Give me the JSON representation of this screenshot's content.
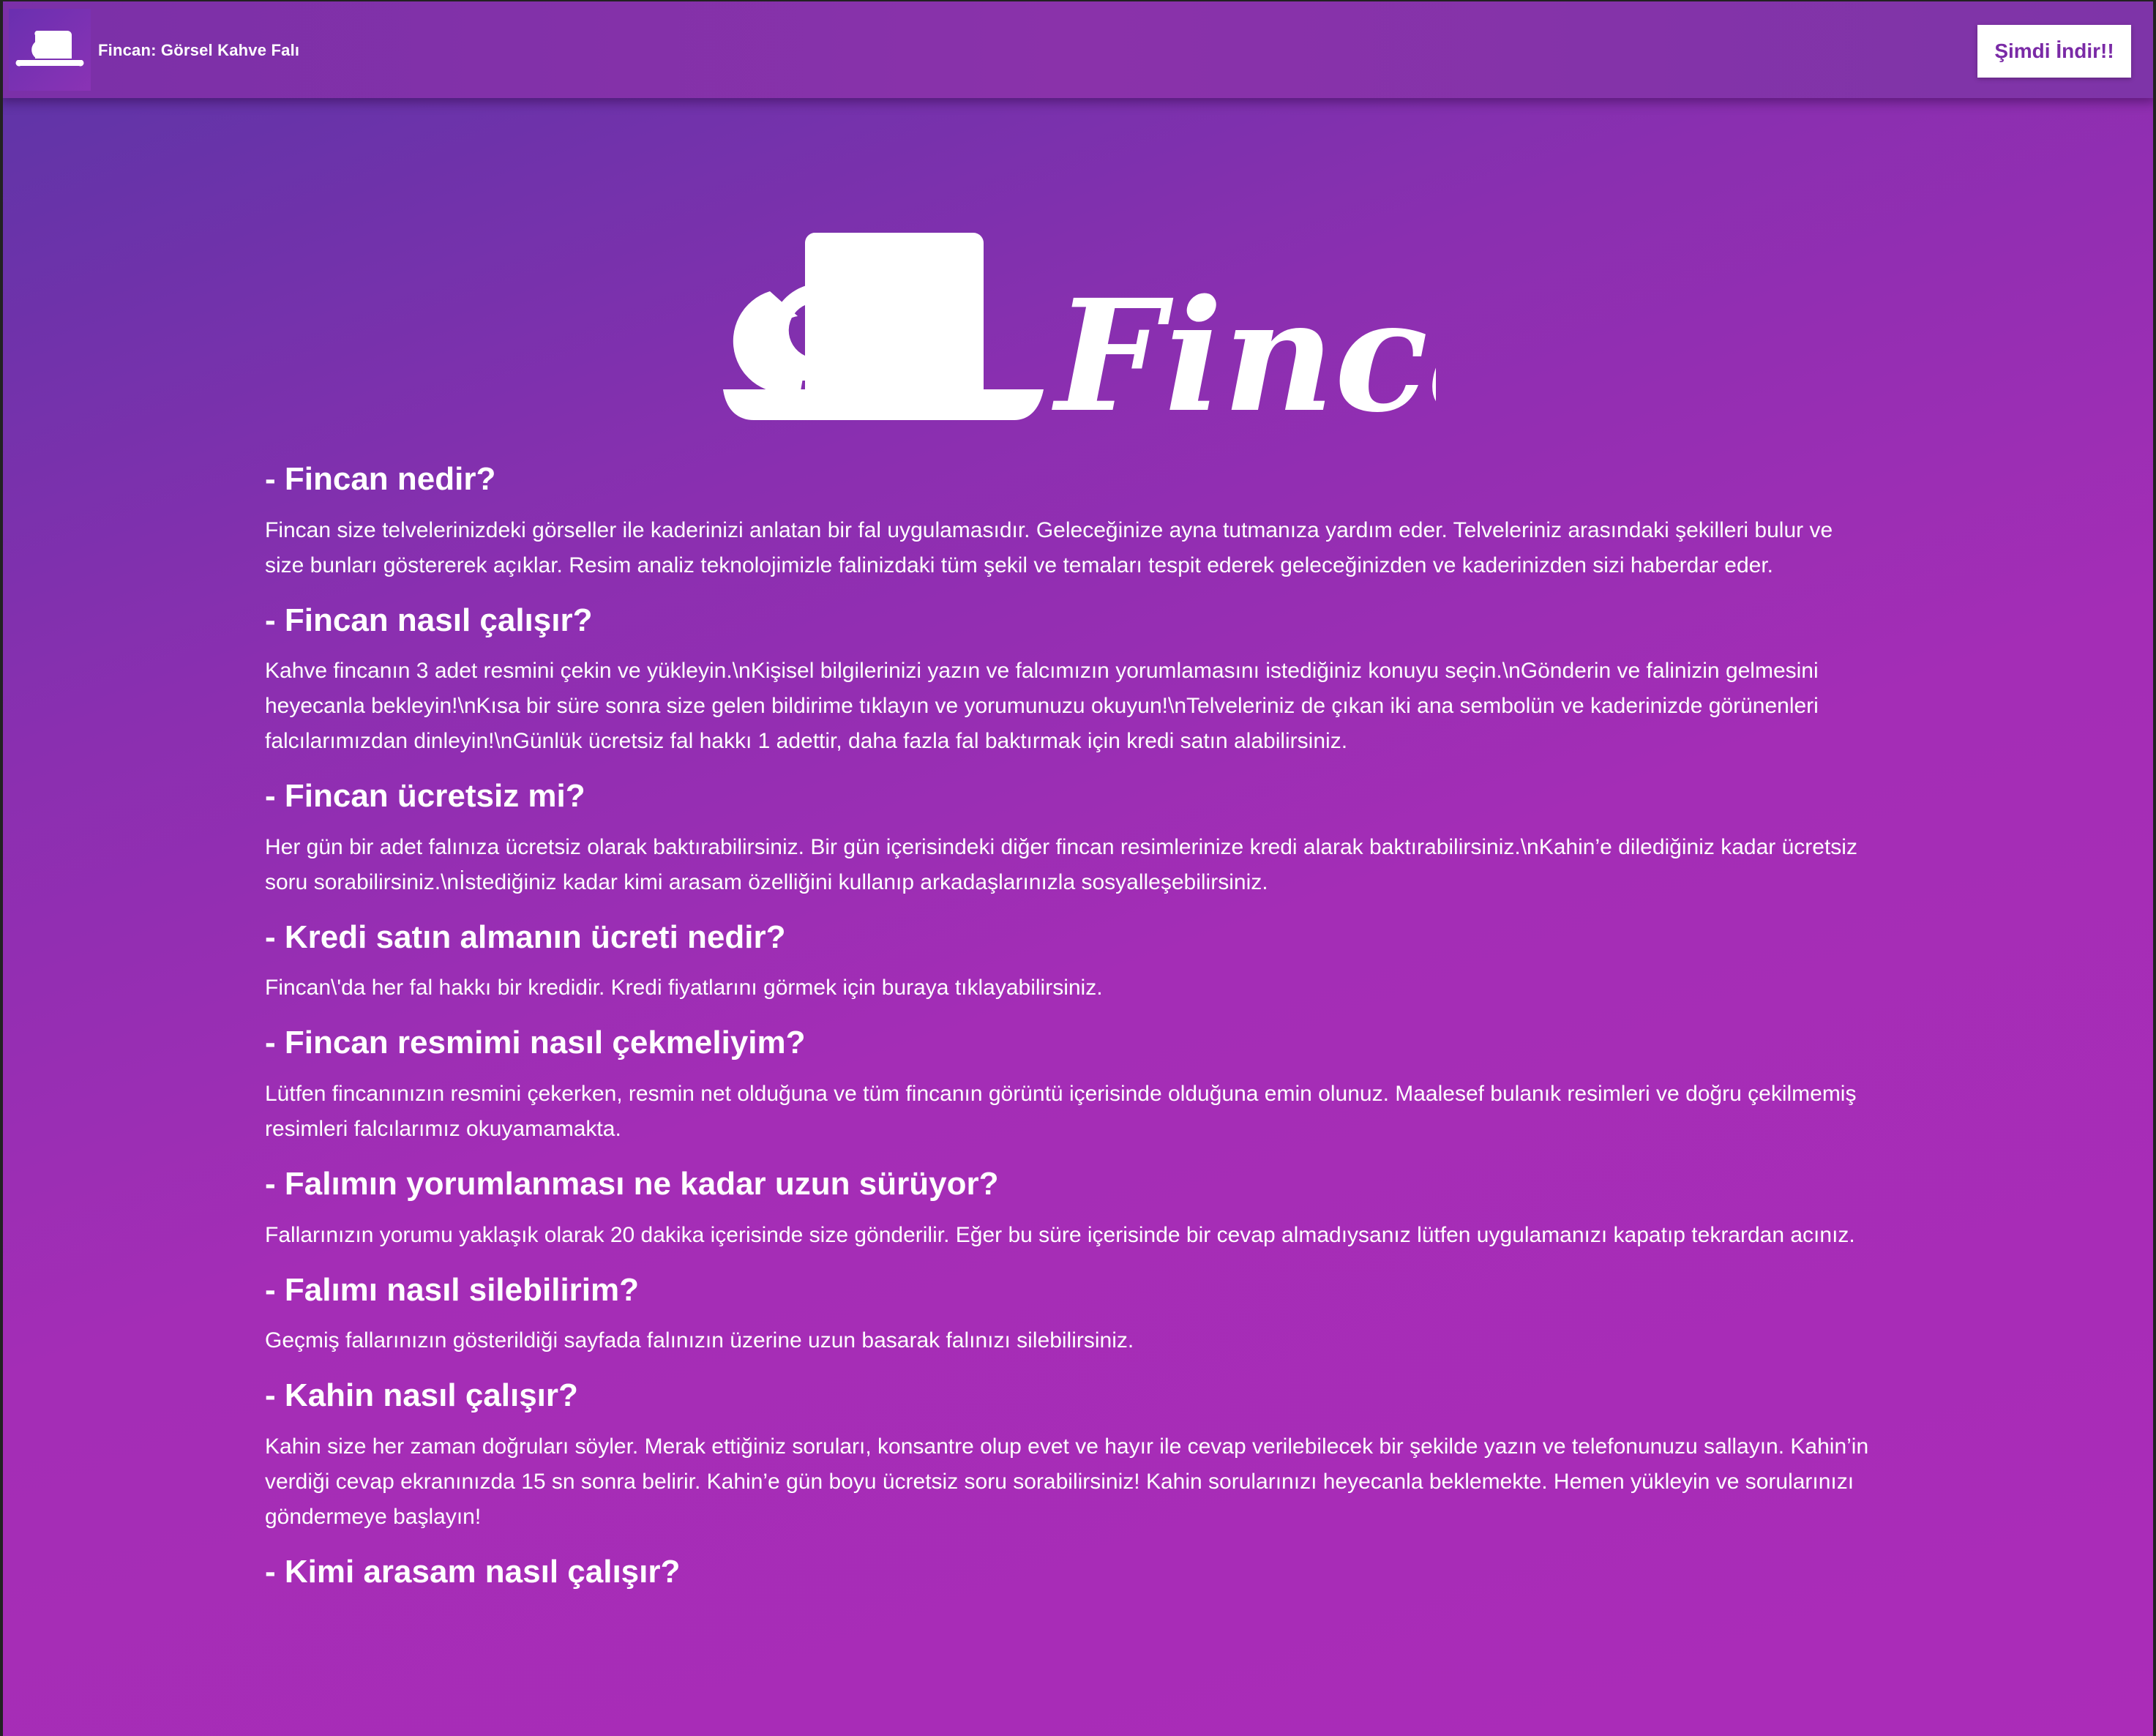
{
  "header": {
    "title": "Fincan: Görsel Kahve Falı",
    "download_label": "Şimdi İndir!!",
    "logo_icon": "coffee-cup-icon"
  },
  "hero": {
    "wordmark": "Fincan",
    "icon": "coffee-cup-icon"
  },
  "colors": {
    "gradient_start": "#5a35a6",
    "gradient_end": "#ab2cb8",
    "button_text": "#7a2aa6"
  },
  "faq": [
    {
      "q": "- Fincan nedir?",
      "a": "Fincan size telvelerinizdeki görseller ile kaderinizi anlatan bir fal uygulamasıdır. Geleceğinize ayna tutmanıza yardım eder. Telveleriniz arasındaki şekilleri bulur ve size bunları göstererek açıklar. Resim analiz teknolojimizle falinizdaki tüm şekil ve temaları tespit ederek geleceğinizden ve kaderinizden sizi haberdar eder."
    },
    {
      "q": "- Fincan nasıl çalışır?",
      "a": "Kahve fincanın 3 adet resmini çekin ve yükleyin.\\nKişisel bilgilerinizi yazın ve falcımızın yorumlamasını istediğiniz konuyu seçin.\\nGönderin ve falinizin gelmesini heyecanla bekleyin!\\nKısa bir süre sonra size gelen bildirime tıklayın ve yorumunuzu okuyun!\\nTelveleriniz de çıkan iki ana sembolün ve kaderinizde görünenleri falcılarımızdan dinleyin!\\nGünlük ücretsiz fal hakkı 1 adettir, daha fazla fal baktırmak için kredi satın alabilirsiniz."
    },
    {
      "q": "- Fincan ücretsiz mi?",
      "a": "Her gün bir adet falınıza ücretsiz olarak baktırabilirsiniz. Bir gün içerisindeki diğer fincan resimlerinize kredi alarak baktırabilirsiniz.\\nKahin’e dilediğiniz kadar ücretsiz soru sorabilirsiniz.\\nİstediğiniz kadar kimi arasam özelliğini kullanıp arkadaşlarınızla sosyalleşebilirsiniz."
    },
    {
      "q": "- Kredi satın almanın ücreti nedir?",
      "a": "Fincan\\'da her fal hakkı bir kredidir. Kredi fiyatlarını görmek için buraya tıklayabilirsiniz."
    },
    {
      "q": "- Fincan resmimi nasıl çekmeliyim?",
      "a": "Lütfen fincanınızın resmini çekerken, resmin net olduğuna ve tüm fincanın görüntü içerisinde olduğuna emin olunuz. Maalesef bulanık resimleri ve doğru çekilmemiş resimleri falcılarımız okuyamamakta."
    },
    {
      "q": "- Falımın yorumlanması ne kadar uzun sürüyor?",
      "a": "Fallarınızın yorumu yaklaşık olarak 20 dakika içerisinde size gönderilir. Eğer bu süre içerisinde bir cevap almadıysanız lütfen uygulamanızı kapatıp tekrardan acınız."
    },
    {
      "q": "- Falımı nasıl silebilirim?",
      "a": "Geçmiş fallarınızın gösterildiği sayfada falınızın üzerine uzun basarak falınızı silebilirsiniz."
    },
    {
      "q": "- Kahin nasıl çalışır?",
      "a": "Kahin size her zaman doğruları söyler. Merak ettiğiniz soruları, konsantre olup evet ve hayır ile cevap verilebilecek bir şekilde yazın ve telefonunuzu sallayın. Kahin’in verdiği cevap ekranınızda 15 sn sonra belirir. Kahin’e gün boyu ücretsiz soru sorabilirsiniz! Kahin sorularınızı heyecanla beklemekte. Hemen yükleyin ve sorularınızı göndermeye başlayın!"
    },
    {
      "q": "- Kimi arasam nasıl çalışır?",
      "a": ""
    }
  ]
}
